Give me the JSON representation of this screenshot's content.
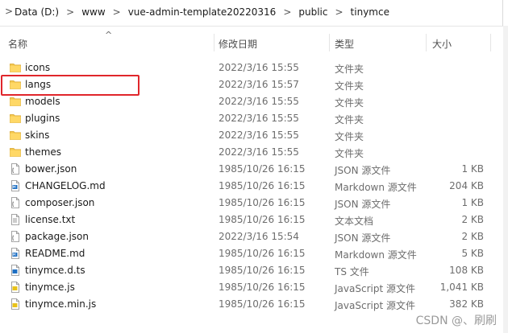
{
  "breadcrumb": {
    "lead": ">",
    "parts": [
      "Data (D:)",
      "www",
      "vue-admin-template20220316",
      "public",
      "tinymce"
    ]
  },
  "columns": {
    "name": "名称",
    "modified": "修改日期",
    "type": "类型",
    "size": "大小"
  },
  "files": [
    {
      "name": "icons",
      "date": "2022/3/16 15:55",
      "type": "文件夹",
      "size": "",
      "icon": "folder-icon"
    },
    {
      "name": "langs",
      "date": "2022/3/16 15:57",
      "type": "文件夹",
      "size": "",
      "icon": "folder-icon"
    },
    {
      "name": "models",
      "date": "2022/3/16 15:55",
      "type": "文件夹",
      "size": "",
      "icon": "folder-icon"
    },
    {
      "name": "plugins",
      "date": "2022/3/16 15:55",
      "type": "文件夹",
      "size": "",
      "icon": "folder-icon"
    },
    {
      "name": "skins",
      "date": "2022/3/16 15:55",
      "type": "文件夹",
      "size": "",
      "icon": "folder-icon"
    },
    {
      "name": "themes",
      "date": "2022/3/16 15:55",
      "type": "文件夹",
      "size": "",
      "icon": "folder-icon"
    },
    {
      "name": "bower.json",
      "date": "1985/10/26 16:15",
      "type": "JSON 源文件",
      "size": "1 KB",
      "icon": "json-file-icon"
    },
    {
      "name": "CHANGELOG.md",
      "date": "1985/10/26 16:15",
      "type": "Markdown 源文件",
      "size": "204 KB",
      "icon": "markdown-file-icon"
    },
    {
      "name": "composer.json",
      "date": "1985/10/26 16:15",
      "type": "JSON 源文件",
      "size": "1 KB",
      "icon": "json-file-icon"
    },
    {
      "name": "license.txt",
      "date": "1985/10/26 16:15",
      "type": "文本文档",
      "size": "2 KB",
      "icon": "text-file-icon"
    },
    {
      "name": "package.json",
      "date": "2022/3/16 15:54",
      "type": "JSON 源文件",
      "size": "2 KB",
      "icon": "json-file-icon"
    },
    {
      "name": "README.md",
      "date": "1985/10/26 16:15",
      "type": "Markdown 源文件",
      "size": "5 KB",
      "icon": "markdown-file-icon"
    },
    {
      "name": "tinymce.d.ts",
      "date": "1985/10/26 16:15",
      "type": "TS 文件",
      "size": "108 KB",
      "icon": "ts-file-icon"
    },
    {
      "name": "tinymce.js",
      "date": "1985/10/26 16:15",
      "type": "JavaScript 源文件",
      "size": "1,041 KB",
      "icon": "js-file-icon"
    },
    {
      "name": "tinymce.min.js",
      "date": "1985/10/26 16:15",
      "type": "JavaScript 源文件",
      "size": "382 KB",
      "icon": "js-file-icon"
    }
  ],
  "watermark": "CSDN @、刷刷",
  "colors": {
    "highlight": "#e0262b",
    "folder": "#f4c74c",
    "vscode_blue": "#1e6fc3"
  }
}
